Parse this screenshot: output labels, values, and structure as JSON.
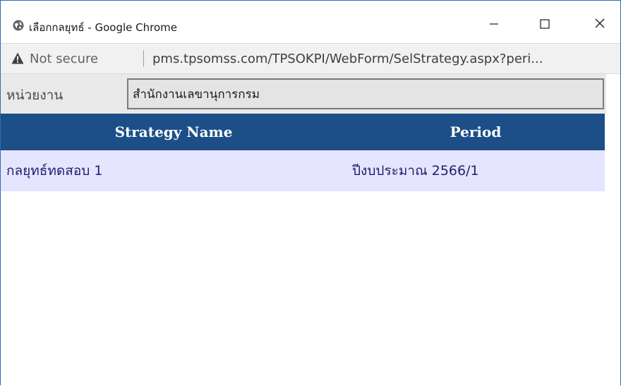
{
  "window": {
    "title": "เลือกกลยุทธ์ - Google Chrome",
    "favicon_icon": "globe-icon",
    "controls": {
      "minimize_icon": "minimize-icon",
      "maximize_icon": "maximize-icon",
      "close_icon": "close-icon"
    }
  },
  "addressbar": {
    "security_icon": "warning-triangle-icon",
    "security_text": "Not secure",
    "url": "pms.tpsomss.com/TPSOKPI/WebForm/SelStrategy.aspx?peri..."
  },
  "unit": {
    "label": "หน่วยงาน",
    "value": "สำนักงานเลขานุการกรม"
  },
  "table": {
    "columns": [
      "Strategy Name",
      "Period"
    ],
    "rows": [
      {
        "name": "กลยุทธ์ทดสอบ 1",
        "period": "ปีงบประมาณ 2566/1"
      }
    ]
  },
  "colors": {
    "header_bg": "#1c4f88",
    "row_bg": "#e5e5ff",
    "row_text": "#20206e",
    "window_border": "#2d6ab8"
  }
}
